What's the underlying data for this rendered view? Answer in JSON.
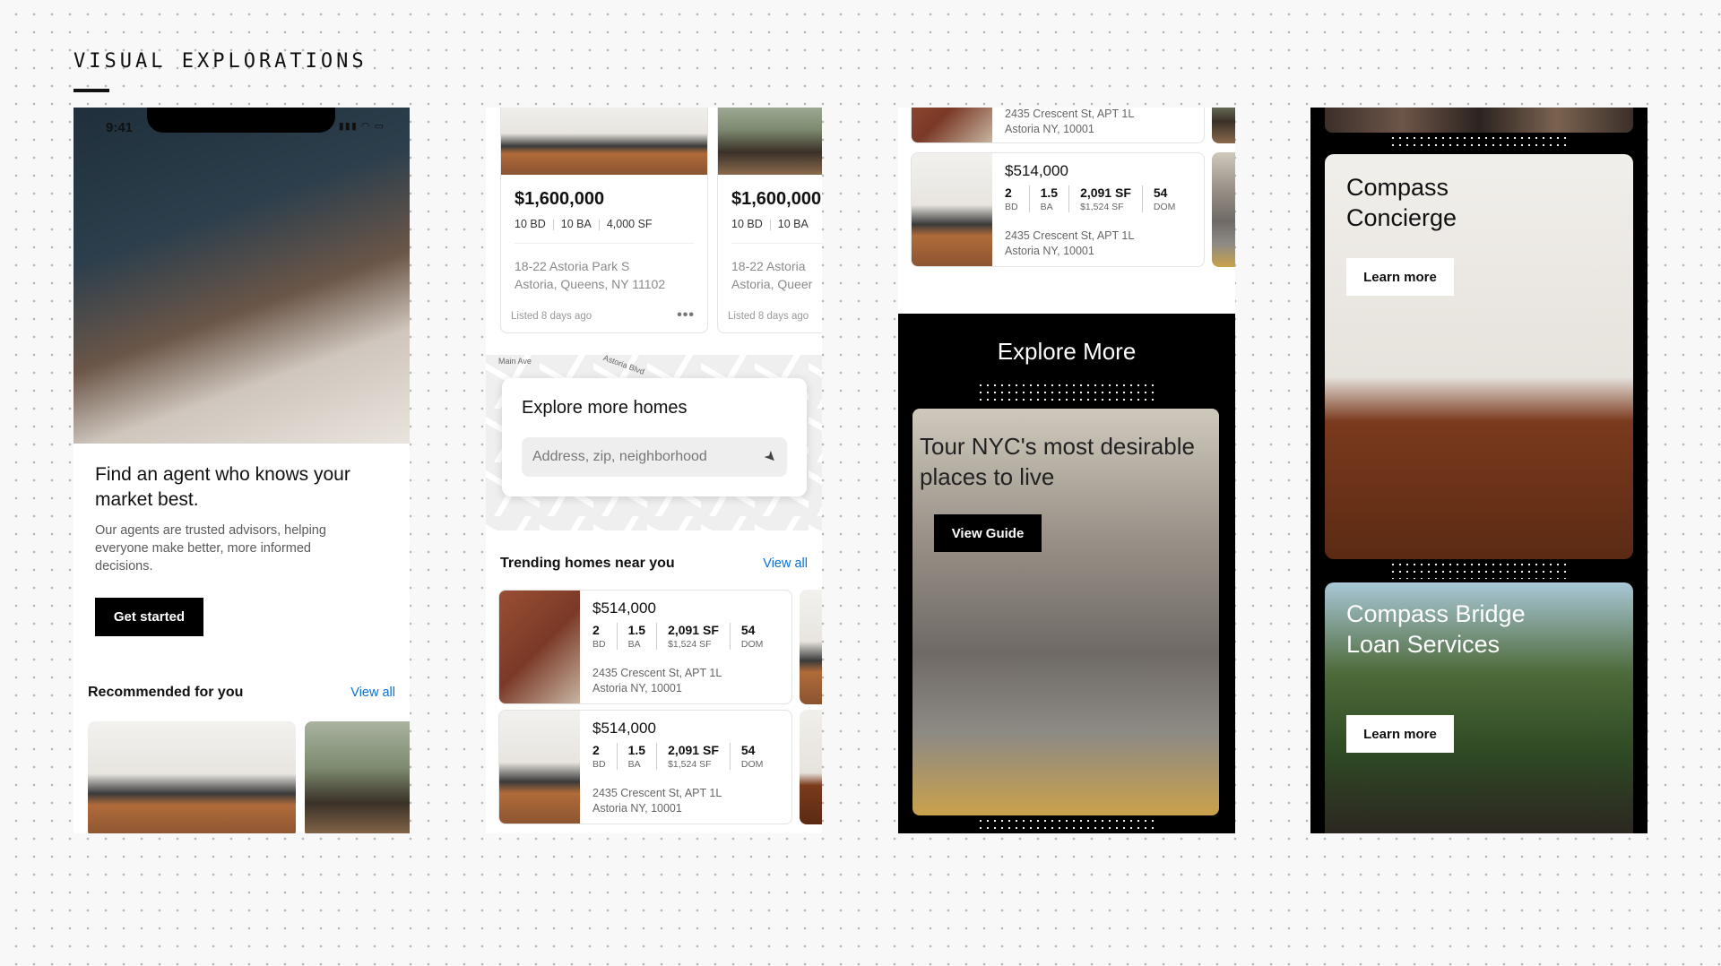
{
  "header": {
    "title": "VISUAL EXPLORATIONS"
  },
  "screen1": {
    "time": "9:41",
    "heading": "Find an agent who knows your market best.",
    "body": "Our agents are trusted advisors, helping everyone make better, more informed decisions.",
    "cta": "Get started",
    "recommended_title": "Recommended for you",
    "view_all": "View all"
  },
  "screen2": {
    "cards": [
      {
        "price": "$1,600,000",
        "bd": "10 BD",
        "ba": "10 BA",
        "sf": "4,000 SF",
        "addr1": "18-22 Astoria Park S",
        "addr2": "Astoria, Queens, NY 11102",
        "listed": "Listed 8 days ago"
      },
      {
        "price": "$1,600,000",
        "bd": "10 BD",
        "ba": "10 BA",
        "addr1": "18-22 Astoria",
        "addr2": "Astoria, Queer",
        "listed": "Listed 8 days ago"
      }
    ],
    "map_labels": [
      "Main Ave",
      "Astoria Blvd"
    ],
    "explore_title": "Explore more homes",
    "search_placeholder": "Address, zip, neighborhood",
    "trending_title": "Trending homes near you",
    "view_all": "View all",
    "listings": [
      {
        "price": "$514,000",
        "bd": "2",
        "bd_u": "BD",
        "ba": "1.5",
        "ba_u": "BA",
        "sf": "2,091 SF",
        "sf_u": "$1,524 SF",
        "dom": "54",
        "dom_u": "DOM",
        "addr1": "2435 Crescent St, APT 1L",
        "addr2": "Astoria NY, 10001"
      },
      {
        "price": "$514,000",
        "bd": "2",
        "bd_u": "BD",
        "ba": "1.5",
        "ba_u": "BA",
        "sf": "2,091 SF",
        "sf_u": "$1,524 SF",
        "dom": "54",
        "dom_u": "DOM",
        "addr1": "2435 Crescent St, APT 1L",
        "addr2": "Astoria NY, 10001"
      }
    ]
  },
  "screen3": {
    "top_listing": {
      "addr1": "2435 Crescent St, APT 1L",
      "addr2": "Astoria NY, 10001"
    },
    "listing": {
      "price": "$514,000",
      "bd": "2",
      "bd_u": "BD",
      "ba": "1.5",
      "ba_u": "BA",
      "sf": "2,091 SF",
      "sf_u": "$1,524 SF",
      "dom": "54",
      "dom_u": "DOM",
      "addr1": "2435 Crescent St, APT 1L",
      "addr2": "Astoria NY, 10001"
    },
    "explore_title": "Explore More",
    "tour_text": "Tour NYC's most desirable places to live",
    "tour_cta": "View Guide"
  },
  "screen4": {
    "concierge_title": "Compass Concierge",
    "concierge_cta": "Learn more",
    "bridge_title": "Compass Bridge Loan Services",
    "bridge_cta": "Learn more"
  },
  "colors": {
    "link": "#0a6fd6",
    "black": "#000000",
    "background": "#f8f8f8"
  }
}
